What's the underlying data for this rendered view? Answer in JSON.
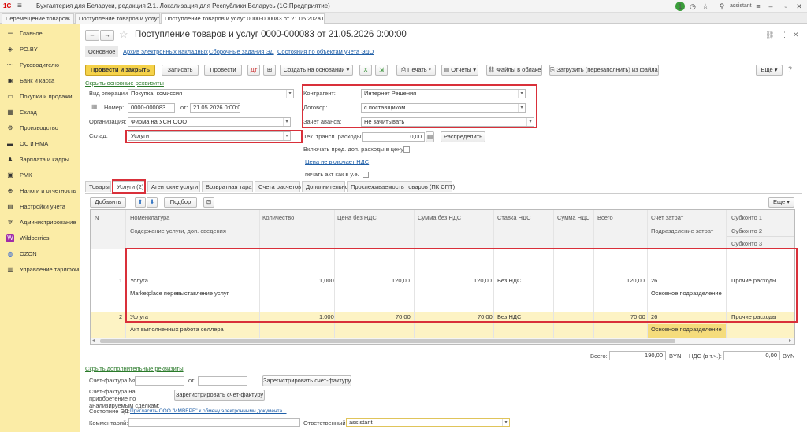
{
  "titlebar": {
    "logo": "1С",
    "title": "Бухгалтерия для Беларуси, редакция 2.1. Локализация для Республики Беларусь   (1С:Предприятие)",
    "notif_count": "1",
    "user": "assistant"
  },
  "tabs": [
    {
      "label": "Перемещение товаров"
    },
    {
      "label": "Поступление товаров и услуг"
    },
    {
      "label": "Поступление товаров и услуг 0000-000083 от 21.05.2026 0:00:00"
    }
  ],
  "sidebar": {
    "items": [
      {
        "label": "Главное",
        "icon": "menu-icon"
      },
      {
        "label": "PO.BY",
        "icon": "po-icon"
      },
      {
        "label": "Руководителю",
        "icon": "chart-icon"
      },
      {
        "label": "Банк и касса",
        "icon": "bank-icon"
      },
      {
        "label": "Покупки и продажи",
        "icon": "cart-icon"
      },
      {
        "label": "Склад",
        "icon": "warehouse-icon"
      },
      {
        "label": "Производство",
        "icon": "factory-icon"
      },
      {
        "label": "ОС и НМА",
        "icon": "truck-icon"
      },
      {
        "label": "Зарплата и кадры",
        "icon": "person-icon"
      },
      {
        "label": "РМК",
        "icon": "register-icon"
      },
      {
        "label": "Налоги и отчетность",
        "icon": "tax-icon"
      },
      {
        "label": "Настройки учета",
        "icon": "settings-doc-icon"
      },
      {
        "label": "Администрирование",
        "icon": "gear-icon"
      },
      {
        "label": "Wildberries",
        "icon": "wb-icon"
      },
      {
        "label": "OZON",
        "icon": "ozon-icon"
      },
      {
        "label": "Управление тарифом",
        "icon": "tariff-icon"
      }
    ]
  },
  "doc": {
    "title": "Поступление товаров и услуг 0000-000083 от 21.05.2026 0:00:00",
    "subtabs": [
      "Основное",
      "Архив электронных накладных",
      "Сборочные задания ЭД",
      "Состояния по объектам учета ЭДО"
    ]
  },
  "toolbar": {
    "post_close": "Провести и закрыть",
    "write": "Записать",
    "post": "Провести",
    "create_based": "Создать на основании",
    "print": "Печать",
    "reports": "Отчеты",
    "cloud_files": "Файлы в облаке",
    "load": "Загрузить (перезаполнить) из файла",
    "more": "Еще"
  },
  "form": {
    "hide_main": "Скрыть основные реквизиты",
    "op_label": "Вид операции:",
    "op_value": "Покупка, комиссия",
    "num_label": "Номер:",
    "num_value": "0000-000083",
    "date_label": "от:",
    "date_value": "21.05.2026  0:00:00",
    "org_label": "Организация:",
    "org_value": "Фирма на УСН ООО",
    "wh_label": "Склад:",
    "wh_value": "Услуги",
    "counterparty_label": "Контрагент:",
    "counterparty_value": "Интернет Решения",
    "contract_label": "Договор:",
    "contract_value": "с поставщиком",
    "advance_label": "Зачет аванса:",
    "advance_value": "Не зачитывать",
    "transport_label": "Тек. трансп. расходы:",
    "transport_value": "0,00",
    "distribute": "Распределить",
    "include_costs": "Включать пред. доп. расходы в цену:",
    "vat_link": "Цена не включает НДС",
    "print_act": "печать акт как в у.е."
  },
  "pagetabs": [
    "Товары",
    "Услуги (2)",
    "Агентские услуги",
    "Возвратная тара",
    "Счета расчетов",
    "Дополнительно",
    "Прослеживаемость товаров (ПК СПТ)"
  ],
  "tabletoolbar": {
    "add": "Добавить",
    "select": "Подбор",
    "more": "Еще"
  },
  "columns": {
    "n": "N",
    "item": "Номенклатура",
    "item2": "Содержание услуги, доп. сведения",
    "qty": "Количество",
    "price": "Цена без НДС",
    "sum": "Сумма без НДС",
    "rate": "Ставка НДС",
    "vat": "Сумма НДС",
    "total": "Всего",
    "account": "Счет затрат",
    "dept": "Подразделение затрат",
    "sub1": "Субконто 1",
    "sub2": "Субконто 2",
    "sub3": "Субконто 3"
  },
  "rows": [
    {
      "n": "1",
      "item": "Услуга",
      "content": "Marketplace перевыставление услуг",
      "qty": "1,000",
      "price": "120,00",
      "sum": "120,00",
      "rate": "Без НДС",
      "vat": "",
      "total": "120,00",
      "account": "26",
      "dept": "Основное подразделение",
      "sub1": "Прочие расходы"
    },
    {
      "n": "2",
      "item": "Услуга",
      "content": "Акт выполненных работа селлера",
      "qty": "1,000",
      "price": "70,00",
      "sum": "70,00",
      "rate": "Без НДС",
      "vat": "",
      "total": "70,00",
      "account": "26",
      "dept": "Основное подразделение",
      "sub1": "Прочие расходы"
    }
  ],
  "totals": {
    "total_label": "Всего:",
    "total_value": "190,00",
    "currency": "BYN",
    "vat_label": "НДС (в т.ч.):",
    "vat_value": "0,00",
    "currency2": "BYN"
  },
  "footer": {
    "hide_extra": "Скрыть дополнительные реквизиты",
    "invoice_label": "Счет-фактура №:",
    "invoice_date_label": "от:",
    "invoice_date_value": ". .",
    "register_invoice": "Зарегистрировать счет-фактуру",
    "invoice_purchase_label": "Счет-фактура на приобретение по анализируемым сделкам:",
    "register_invoice2": "Зарегистрировать счет-фактуру",
    "ed_label": "Состояние ЭД:",
    "ed_link": "Пригласить ООО \"ИМВЕРБ\" к обмену электронными документа...",
    "comment_label": "Комментарий:",
    "responsible_label": "Ответственный:",
    "responsible_value": "assistant"
  }
}
